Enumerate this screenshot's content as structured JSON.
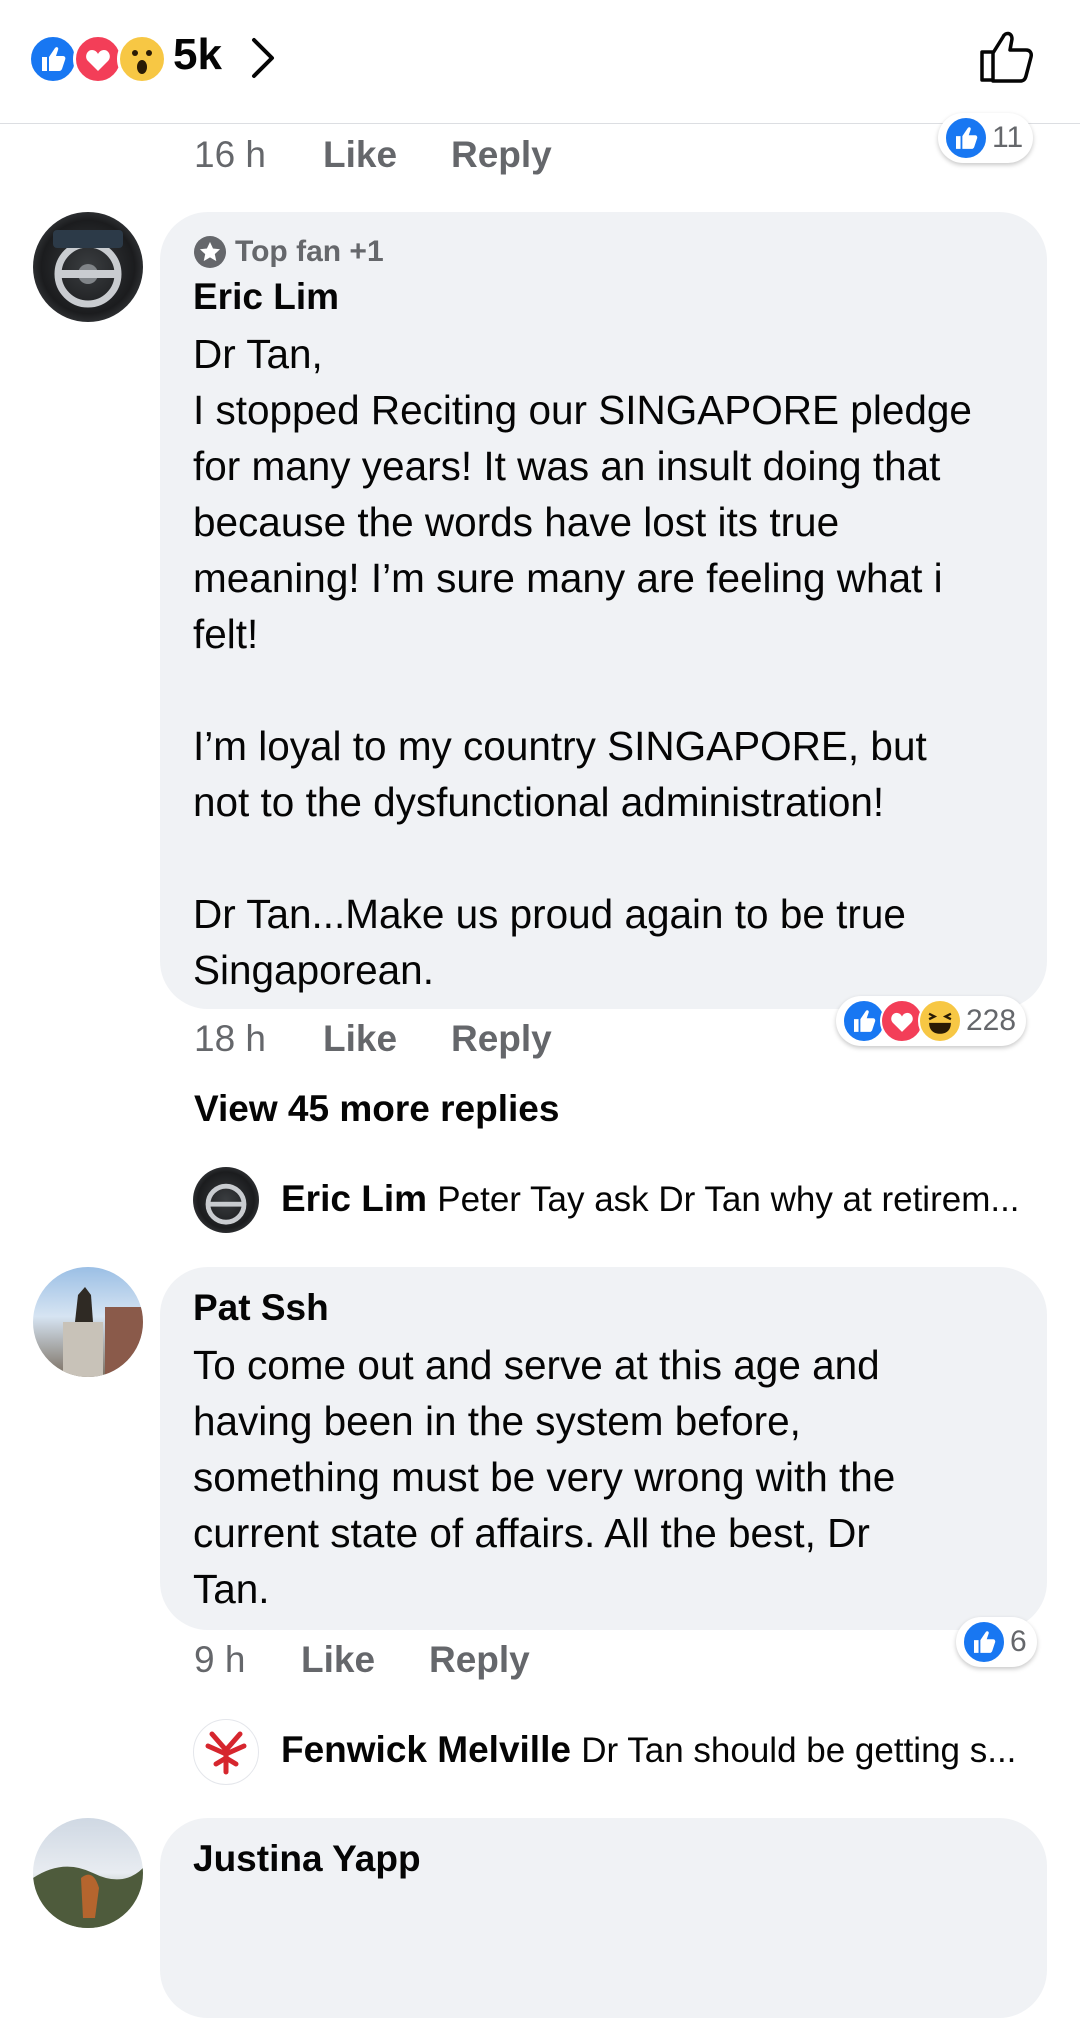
{
  "header": {
    "reactions": [
      "like",
      "love",
      "wow"
    ],
    "count": "5k",
    "icons": {
      "chevron": "chevron-right-icon",
      "like": "thumbs-up-outline-icon"
    }
  },
  "previous_comment": {
    "time": "16 h",
    "like": "Like",
    "reply": "Reply",
    "reaction_count": "11"
  },
  "comments": [
    {
      "badge": "Top fan +1",
      "author": "Eric Lim",
      "body": "Dr Tan,\nI stopped Reciting our SINGAPORE pledge\nfor many years! It was an insult doing that\nbecause the words have lost its true\nmeaning! I’m sure many are feeling what i\nfelt!\n\nI’m loyal to my country SINGAPORE, but\nnot to the dysfunctional administration!\n\nDr Tan...Make us proud again to be true\nSingaporean.",
      "time": "18 h",
      "like": "Like",
      "reply": "Reply",
      "reactions": [
        "like",
        "love",
        "haha"
      ],
      "reaction_count": "228",
      "view_more": "View 45 more replies",
      "latest_reply": {
        "author": "Eric Lim",
        "text": "Peter Tay ask Dr Tan why at retirem..."
      }
    },
    {
      "author": "Pat Ssh",
      "body": "To come out and serve at this age and\nhaving been in the system before,\nsomething must be very wrong with the\ncurrent state of affairs. All the best, Dr\nTan.",
      "time": "9 h",
      "like": "Like",
      "reply": "Reply",
      "reactions": [
        "like"
      ],
      "reaction_count": "6",
      "latest_reply": {
        "author": "Fenwick Melville",
        "text": "Dr Tan should be getting s..."
      }
    },
    {
      "author": "Justina Yapp"
    }
  ],
  "colors": {
    "like_blue": "#1877f2",
    "love_red": "#f33e58",
    "bubble": "#f0f2f5",
    "meta_gray": "#65676b"
  }
}
